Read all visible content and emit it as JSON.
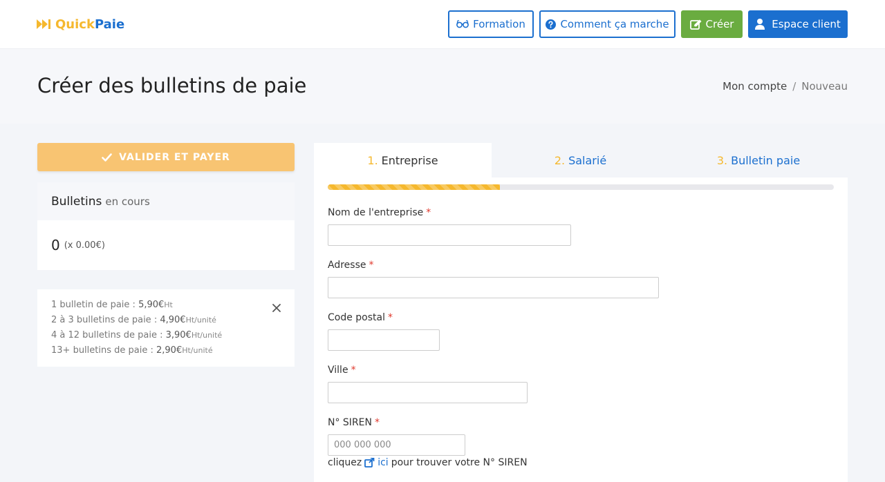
{
  "brand": {
    "part1": "Quick",
    "part2": "Paie"
  },
  "nav": {
    "formation": "Formation",
    "comment": "Comment ça marche",
    "creer": "Créer",
    "espace": "Espace client"
  },
  "page": {
    "title": "Créer des bulletins de paie",
    "breadcrumb": [
      "Mon compte",
      "/",
      "Nouveau"
    ]
  },
  "sidebar": {
    "validate_label": "VALIDER ET PAYER",
    "bulletins_title": "Bulletins",
    "bulletins_sub": "en cours",
    "count": "0",
    "multiplier": "(x 0.00€)",
    "prices": [
      {
        "label": "1 bulletin de paie :",
        "amount": "5,90€",
        "unit": "Ht"
      },
      {
        "label": "2 à 3 bulletins de paie :",
        "amount": "4,90€",
        "unit": "Ht/unité"
      },
      {
        "label": "4 à 12 bulletins de paie :",
        "amount": "3,90€",
        "unit": "Ht/unité"
      },
      {
        "label": "13+ bulletins de paie :",
        "amount": "2,90€",
        "unit": "Ht/unité"
      }
    ]
  },
  "tabs": [
    {
      "num": "1.",
      "label": "Entreprise"
    },
    {
      "num": "2.",
      "label": "Salarié"
    },
    {
      "num": "3.",
      "label": "Bulletin paie"
    }
  ],
  "progress": {
    "value_percent": 34
  },
  "form": {
    "required_mark": "*",
    "nom_label": "Nom de l'entreprise",
    "nom_value": "",
    "adresse_label": "Adresse",
    "adresse_value": "",
    "cp_label": "Code postal",
    "cp_value": "",
    "ville_label": "Ville",
    "ville_value": "",
    "siren_label": "N° SIREN",
    "siren_placeholder": "000 000 000",
    "siren_help_before": "cliquez",
    "siren_help_link": "ici",
    "siren_help_after": "pour trouver votre N° SIREN"
  },
  "colors": {
    "primary": "#1b6fcf",
    "accent": "#f5b82e",
    "success": "#6aac40",
    "validate": "#f8c472",
    "required": "#e0392d"
  },
  "icons": {
    "brand": "fast-forward-icon",
    "formation": "glasses-icon",
    "comment": "question-circle-icon",
    "creer": "edit-icon",
    "espace": "user-icon",
    "validate": "check-icon",
    "close": "close-icon",
    "siren_link": "external-link-icon"
  }
}
